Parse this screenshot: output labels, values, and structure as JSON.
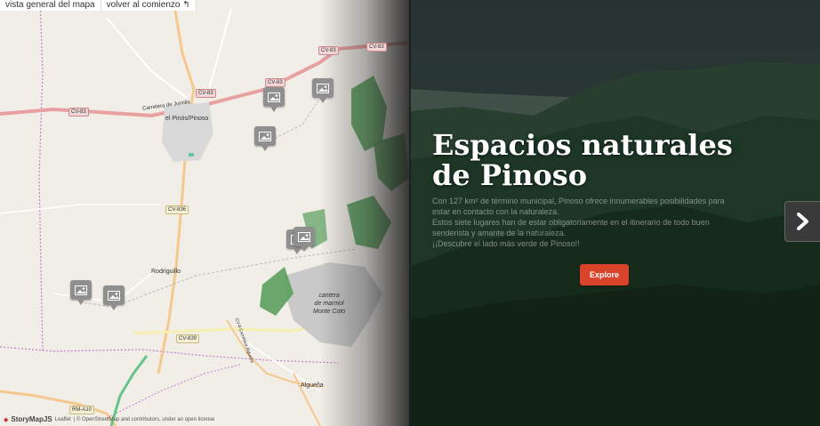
{
  "topbar": {
    "overview_label": "vista general del mapa",
    "back_label": "volver al comienzo"
  },
  "map": {
    "places": {
      "town": "el Pinós/Pinoso",
      "rodriguillo": "Rodriguillo",
      "quarry_line1": "cantera",
      "quarry_line2": "de marmol",
      "quarry_line3": "Monte Coto",
      "algueña": "Algueña",
      "carrer": "Carretera de Jumilla",
      "road_side": "CV-8 Carretera Algueña"
    },
    "roads": [
      "CV-83",
      "CV-83",
      "CV-83",
      "CV-83",
      "CV-83",
      "CV-836",
      "CV-839",
      "RM-A10",
      "CV-83"
    ],
    "attribution": {
      "brand": "StoryMapJS",
      "leaflet": "Leaflet",
      "rest": "| © OpenStreetMap and contributors, under an open license"
    }
  },
  "slide": {
    "title_line1": "Espacios naturales",
    "title_line2": "de Pinoso",
    "desc_line1": "Con 127 km² de término municipal, Pinoso ofrece innumerables posibilidades para",
    "desc_line2": "estar en contacto con la naturaleza.",
    "desc_line3": "Estos siete lugares  han de estar obligatoriamente en el itinerario de todo buen",
    "desc_line4": "senderista y amante de la naturaleza.",
    "desc_line5": "¡¡Descubre el lado más verde de Pinoso!!",
    "explore_label": "Explore",
    "next_icon": "chevron-right-icon"
  },
  "colors": {
    "accent": "#d9432a",
    "marker": "#8f8f8f",
    "forest": "#5a9e5c"
  }
}
